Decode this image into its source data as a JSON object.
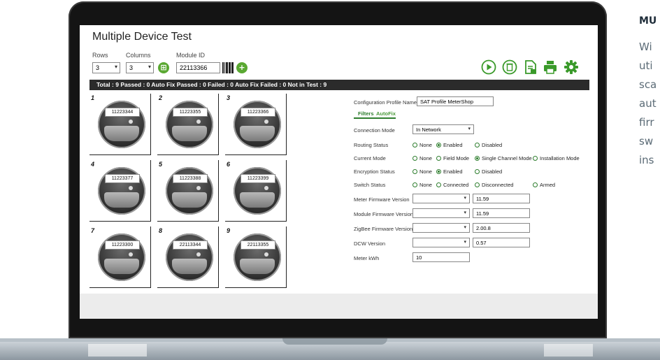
{
  "app": {
    "title": "Multiple Device Test",
    "rows_label": "Rows",
    "columns_label": "Columns",
    "module_id_label": "Module ID",
    "rows_value": "3",
    "columns_value": "3",
    "module_id_value": "22113366"
  },
  "summary": {
    "text": "Total : 9   Passed : 0   Auto Fix Passed : 0   Failed : 0   Auto Fix Failed : 0   Not in Test : 9"
  },
  "toolbar": {
    "icons": [
      "play-icon",
      "delete-icon",
      "export-icon",
      "print-icon",
      "settings-icon"
    ],
    "accent_color": "#3a9a2a"
  },
  "devices": [
    {
      "number": "1",
      "id": "11223344"
    },
    {
      "number": "2",
      "id": "11223355"
    },
    {
      "number": "3",
      "id": "11223366"
    },
    {
      "number": "4",
      "id": "11223377"
    },
    {
      "number": "5",
      "id": "11223388"
    },
    {
      "number": "6",
      "id": "11223399"
    },
    {
      "number": "7",
      "id": "11223300"
    },
    {
      "number": "8",
      "id": "22113344"
    },
    {
      "number": "9",
      "id": "22113355"
    }
  ],
  "config": {
    "profile_label": "Configuration Profile Name",
    "profile_value": "SAT Profile MeterShop",
    "tabs": [
      "Filters",
      "AutoFix"
    ],
    "connection_mode_label": "Connection Mode",
    "connection_mode_value": "In Network",
    "routing_status_label": "Routing Status",
    "routing_options": [
      "None",
      "Enabled",
      "Disabled"
    ],
    "current_mode_label": "Current Mode",
    "current_mode_options": [
      "None",
      "Field Mode",
      "Single Channel Mode",
      "Installation Mode"
    ],
    "encryption_status_label": "Encryption Status",
    "encryption_options": [
      "None",
      "Enabled",
      "Disabled"
    ],
    "switch_status_label": "Switch Status",
    "switch_options": [
      "None",
      "Connected",
      "Disconnected",
      "Armed"
    ],
    "meter_fw_label": "Meter Firmware Version",
    "meter_fw_value": "11.59",
    "module_fw_label": "Module Firmware Version",
    "module_fw_value": "11.59",
    "zigbee_fw_label": "ZigBee Firmware Version",
    "zigbee_fw_value": "2.00.8",
    "dcw_label": "DCW Version",
    "dcw_value": "0.57",
    "meter_kwh_label": "Meter kWh",
    "meter_kwh_value": "10"
  },
  "side_text": {
    "title": "MU",
    "lines": [
      "Wi",
      "uti",
      "sca",
      "aut",
      "firr",
      "sw",
      "ins"
    ]
  }
}
